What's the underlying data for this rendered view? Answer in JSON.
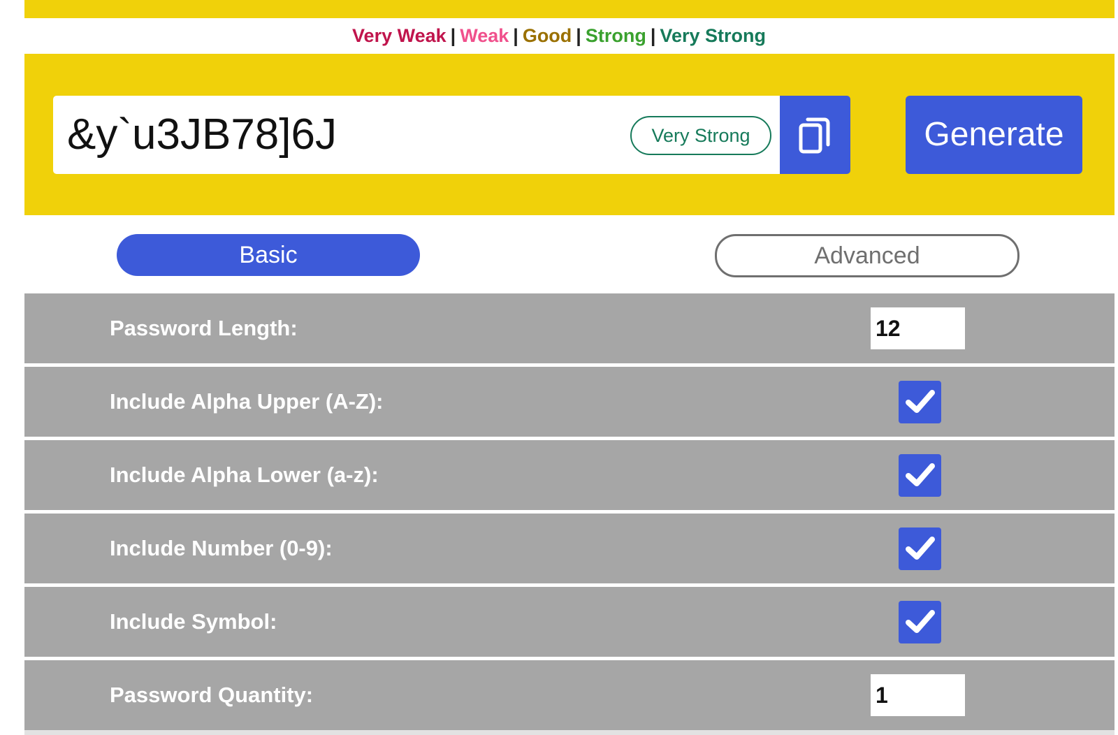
{
  "strength_legend": [
    {
      "label": "Very Weak",
      "color": "#c0144c"
    },
    {
      "label": "Weak",
      "color": "#f0508c"
    },
    {
      "label": "Good",
      "color": "#9a7000"
    },
    {
      "label": "Strong",
      "color": "#3aa12e"
    },
    {
      "label": "Very Strong",
      "color": "#167a5a"
    }
  ],
  "legend_separator": "|",
  "password": {
    "value": "&y`u3JB78]6J",
    "strength_label": "Very Strong",
    "copy_icon": "copy-icon"
  },
  "generate_label": "Generate",
  "tabs": {
    "basic": "Basic",
    "advanced": "Advanced",
    "active": "Basic"
  },
  "options": {
    "length": {
      "label": "Password Length:",
      "value": "12"
    },
    "upper": {
      "label": "Include Alpha Upper (A-Z):",
      "checked": true
    },
    "lower": {
      "label": "Include Alpha Lower (a-z):",
      "checked": true
    },
    "number": {
      "label": "Include Number (0-9):",
      "checked": true
    },
    "symbol": {
      "label": "Include Symbol:",
      "checked": true
    },
    "quantity": {
      "label": "Password Quantity:",
      "value": "1"
    }
  },
  "colors": {
    "accent": "#3d5ad9",
    "panel": "#f0d10a",
    "row": "#a6a6a6"
  }
}
